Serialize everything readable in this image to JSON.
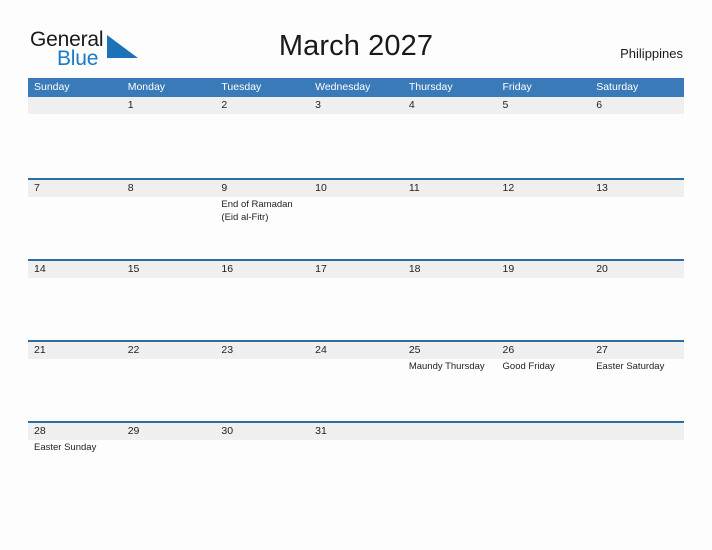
{
  "brand": {
    "name_part1": "General",
    "name_part2": "Blue",
    "flag_icon": "blue-triangle-flag-icon",
    "color_text": "#1a1a1a",
    "color_accent": "#1a7ac4"
  },
  "header": {
    "title": "March 2027",
    "country": "Philippines"
  },
  "theme": {
    "header_blue": "#3a7ab8",
    "row_divider_blue": "#2e6da4",
    "date_strip_gray": "#efefef",
    "page_background": "#fdfdfd",
    "text_color": "#1f1f1f"
  },
  "calendar": {
    "month": "March",
    "year": "2027",
    "weekday_headers": [
      "Sunday",
      "Monday",
      "Tuesday",
      "Wednesday",
      "Thursday",
      "Friday",
      "Saturday"
    ],
    "weeks": [
      [
        {
          "day": "",
          "events": []
        },
        {
          "day": "1",
          "events": []
        },
        {
          "day": "2",
          "events": []
        },
        {
          "day": "3",
          "events": []
        },
        {
          "day": "4",
          "events": []
        },
        {
          "day": "5",
          "events": []
        },
        {
          "day": "6",
          "events": []
        }
      ],
      [
        {
          "day": "7",
          "events": []
        },
        {
          "day": "8",
          "events": []
        },
        {
          "day": "9",
          "events": [
            "End of Ramadan",
            "(Eid al-Fitr)"
          ]
        },
        {
          "day": "10",
          "events": []
        },
        {
          "day": "11",
          "events": []
        },
        {
          "day": "12",
          "events": []
        },
        {
          "day": "13",
          "events": []
        }
      ],
      [
        {
          "day": "14",
          "events": []
        },
        {
          "day": "15",
          "events": []
        },
        {
          "day": "16",
          "events": []
        },
        {
          "day": "17",
          "events": []
        },
        {
          "day": "18",
          "events": []
        },
        {
          "day": "19",
          "events": []
        },
        {
          "day": "20",
          "events": []
        }
      ],
      [
        {
          "day": "21",
          "events": []
        },
        {
          "day": "22",
          "events": []
        },
        {
          "day": "23",
          "events": []
        },
        {
          "day": "24",
          "events": []
        },
        {
          "day": "25",
          "events": [
            "Maundy Thursday"
          ]
        },
        {
          "day": "26",
          "events": [
            "Good Friday"
          ]
        },
        {
          "day": "27",
          "events": [
            "Easter Saturday"
          ]
        }
      ],
      [
        {
          "day": "28",
          "events": [
            "Easter Sunday"
          ]
        },
        {
          "day": "29",
          "events": []
        },
        {
          "day": "30",
          "events": []
        },
        {
          "day": "31",
          "events": []
        },
        {
          "day": "",
          "events": []
        },
        {
          "day": "",
          "events": []
        },
        {
          "day": "",
          "events": []
        }
      ]
    ]
  }
}
